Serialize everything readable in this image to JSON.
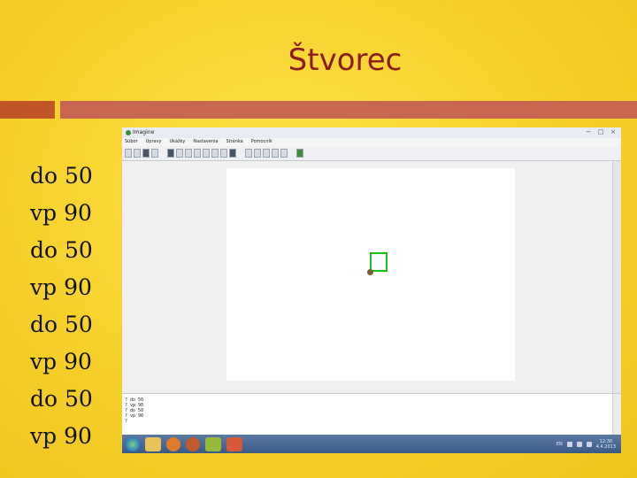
{
  "slide": {
    "title": "Štvorec",
    "code_lines": [
      "do 50",
      "vp 90",
      "do 50",
      "vp 90",
      "do 50",
      "vp 90",
      "do 50",
      "vp 90"
    ]
  },
  "window": {
    "app_title": "Imagine",
    "menu": [
      "Súbor",
      "Úpravy",
      "Ukážky",
      "Nastavenia",
      "Stránka",
      "Pomocník"
    ],
    "controls": [
      "−",
      "□",
      "×"
    ]
  },
  "console": {
    "lines": [
      "? do 50",
      "? vp 90",
      "? do 50",
      "? vp 90",
      "?"
    ]
  },
  "tray": {
    "lang": "EN",
    "time": "12:30",
    "date": "4.4.2013"
  },
  "colors": {
    "title": "#8b1c1c",
    "square_stroke": "#19c119",
    "background": "#f6d12a"
  }
}
